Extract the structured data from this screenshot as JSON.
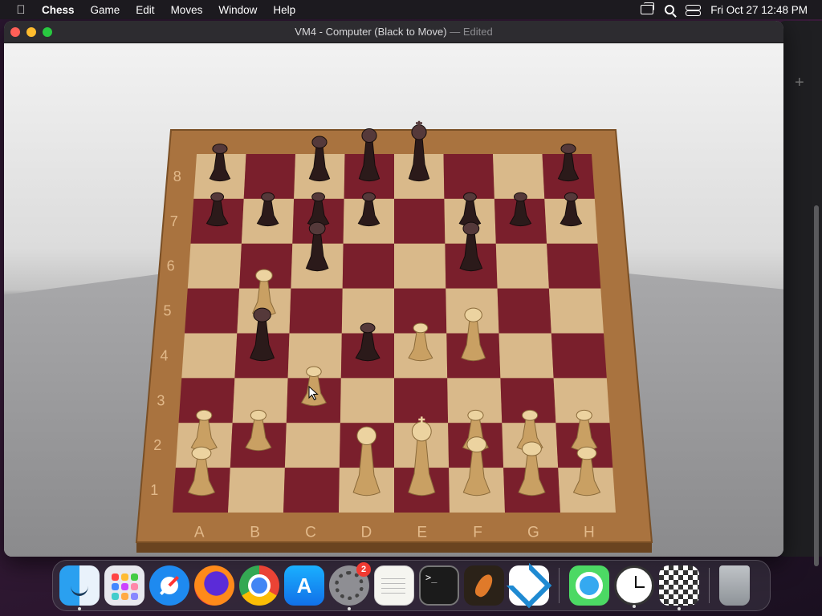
{
  "menubar": {
    "app_name": "Chess",
    "items": [
      "Game",
      "Edit",
      "Moves",
      "Window",
      "Help"
    ],
    "datetime": "Fri Oct 27  12:48 PM"
  },
  "window": {
    "title": "VM4 - Computer  (Black to Move)",
    "separator": "—",
    "edited": "Edited"
  },
  "board": {
    "files": [
      "A",
      "B",
      "C",
      "D",
      "E",
      "F",
      "G",
      "H"
    ],
    "ranks": [
      "1",
      "2",
      "3",
      "4",
      "5",
      "6",
      "7",
      "8"
    ],
    "light_square": "#d9b98a",
    "dark_square": "#7a1f2c",
    "frame_color": "#a9733f",
    "pieces": [
      {
        "square": "a8",
        "color": "black",
        "type": "rook"
      },
      {
        "square": "c8",
        "color": "black",
        "type": "bishop"
      },
      {
        "square": "d8",
        "color": "black",
        "type": "queen"
      },
      {
        "square": "e8",
        "color": "black",
        "type": "king"
      },
      {
        "square": "h8",
        "color": "black",
        "type": "rook"
      },
      {
        "square": "a7",
        "color": "black",
        "type": "pawn"
      },
      {
        "square": "b7",
        "color": "black",
        "type": "pawn"
      },
      {
        "square": "c7",
        "color": "black",
        "type": "pawn"
      },
      {
        "square": "d7",
        "color": "black",
        "type": "pawn"
      },
      {
        "square": "f7",
        "color": "black",
        "type": "pawn"
      },
      {
        "square": "g7",
        "color": "black",
        "type": "pawn"
      },
      {
        "square": "h7",
        "color": "black",
        "type": "pawn"
      },
      {
        "square": "c6",
        "color": "black",
        "type": "bishop"
      },
      {
        "square": "f6",
        "color": "black",
        "type": "bishop"
      },
      {
        "square": "b4",
        "color": "black",
        "type": "bishop"
      },
      {
        "square": "d4",
        "color": "black",
        "type": "pawn"
      },
      {
        "square": "b5",
        "color": "white",
        "type": "knight"
      },
      {
        "square": "e4",
        "color": "white",
        "type": "pawn"
      },
      {
        "square": "f4",
        "color": "white",
        "type": "bishop"
      },
      {
        "square": "c3",
        "color": "white",
        "type": "pawn"
      },
      {
        "square": "a2",
        "color": "white",
        "type": "pawn"
      },
      {
        "square": "b2",
        "color": "white",
        "type": "pawn"
      },
      {
        "square": "f2",
        "color": "white",
        "type": "pawn"
      },
      {
        "square": "g2",
        "color": "white",
        "type": "pawn"
      },
      {
        "square": "h2",
        "color": "white",
        "type": "pawn"
      },
      {
        "square": "a1",
        "color": "white",
        "type": "rook"
      },
      {
        "square": "d1",
        "color": "white",
        "type": "queen"
      },
      {
        "square": "e1",
        "color": "white",
        "type": "king"
      },
      {
        "square": "f1",
        "color": "white",
        "type": "bishop"
      },
      {
        "square": "g1",
        "color": "white",
        "type": "knight"
      },
      {
        "square": "h1",
        "color": "white",
        "type": "rook"
      }
    ]
  },
  "dock": {
    "items": [
      {
        "name": "finder-icon",
        "running": true
      },
      {
        "name": "launchpad-icon",
        "running": false
      },
      {
        "name": "safari-icon",
        "running": false
      },
      {
        "name": "firefox-icon",
        "running": false
      },
      {
        "name": "chrome-icon",
        "running": false
      },
      {
        "name": "app-store-icon",
        "running": false
      },
      {
        "name": "system-settings-icon",
        "running": true,
        "badge": "2"
      },
      {
        "name": "textedit-icon",
        "running": false
      },
      {
        "name": "terminal-icon",
        "running": false
      },
      {
        "name": "garageband-icon",
        "running": false
      },
      {
        "name": "vscode-icon",
        "running": false
      },
      {
        "name": "find-my-icon",
        "running": false
      },
      {
        "name": "clock-icon",
        "running": true
      },
      {
        "name": "chess-icon",
        "running": true
      },
      {
        "name": "trash-icon",
        "running": false
      }
    ],
    "settings_badge": "2",
    "terminal_prompt": ">_"
  }
}
